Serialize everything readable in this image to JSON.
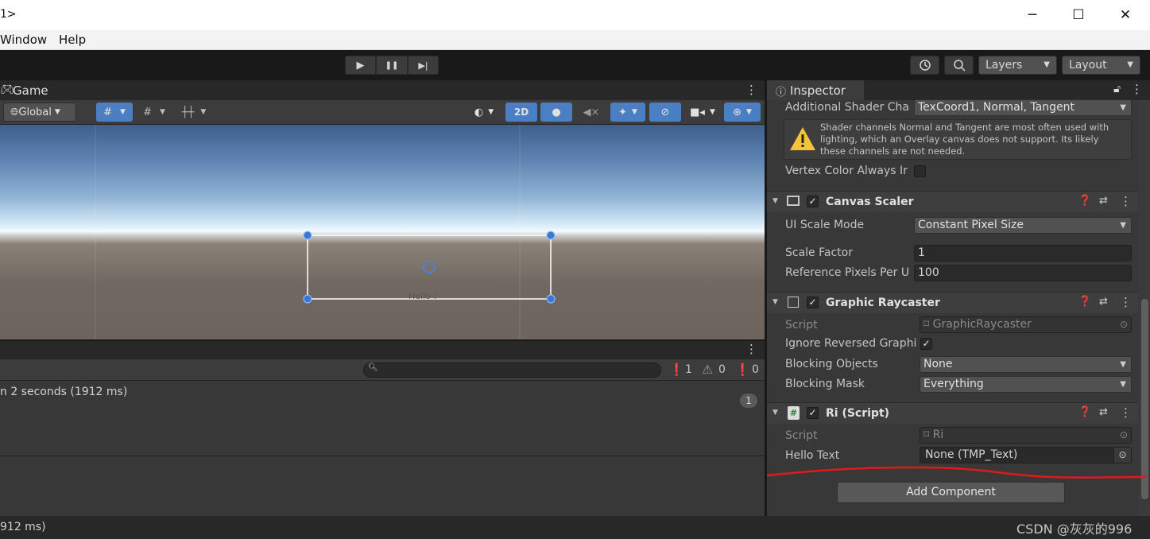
{
  "window": {
    "title": "1>",
    "minimize": "─",
    "maximize": "☐",
    "close": "✕"
  },
  "menu": {
    "items": [
      "Window",
      "Help"
    ]
  },
  "toolbar": {
    "play": "▶",
    "pause": "❚❚",
    "step": "▶|",
    "history_icon": "history-icon",
    "search_icon": "search-icon",
    "layers_label": "Layers",
    "layout_label": "Layout"
  },
  "scene": {
    "tab_label": "Game",
    "global_label": "Global",
    "two_d_label": "2D",
    "canvas_text": "Hello !",
    "accent_color": "#4b7fc4"
  },
  "console": {
    "search_placeholder": "",
    "error_count": "1",
    "warning_count": "0",
    "info_count": "0",
    "message": "n 2 seconds (1912 ms)",
    "message_count": "1",
    "status_text": "912 ms)"
  },
  "inspector": {
    "tab_label": "Inspector",
    "canvas_props": {
      "shader_label": "Additional Shader Cha",
      "shader_value": "TexCoord1, Normal, Tangent",
      "warning": "Shader channels Normal and Tangent are most often used with lighting, which an Overlay canvas does not support. Its likely these channels are not needed.",
      "vertex_label": "Vertex Color Always Ir"
    },
    "canvas_scaler": {
      "name": "Canvas Scaler",
      "scale_mode_label": "UI Scale Mode",
      "scale_mode_value": "Constant Pixel Size",
      "scale_factor_label": "Scale Factor",
      "scale_factor_value": "1",
      "ref_pixels_label": "Reference Pixels Per U",
      "ref_pixels_value": "100"
    },
    "graphic_raycaster": {
      "name": "Graphic Raycaster",
      "script_label": "Script",
      "script_value": "GraphicRaycaster",
      "ignore_label": "Ignore Reversed Graphi",
      "blocking_objects_label": "Blocking Objects",
      "blocking_objects_value": "None",
      "blocking_mask_label": "Blocking Mask",
      "blocking_mask_value": "Everything"
    },
    "ri_script": {
      "name": "Ri (Script)",
      "script_label": "Script",
      "script_value": "Ri",
      "hello_label": "Hello Text",
      "hello_value": "None (TMP_Text)"
    },
    "add_component": "Add Component"
  },
  "watermark": "CSDN @灰灰的996",
  "annotation_color": "#e0191b"
}
